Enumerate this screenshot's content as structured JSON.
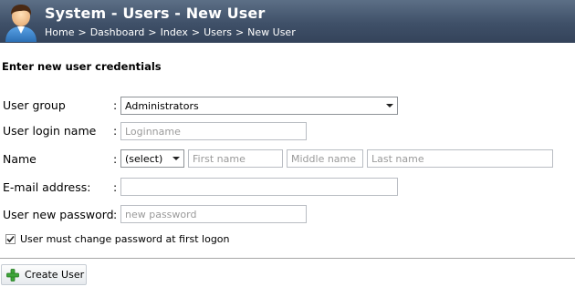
{
  "header": {
    "title": "System - Users - New User",
    "breadcrumb": [
      "Home",
      "Dashboard",
      "Index",
      "Users",
      "New User"
    ],
    "breadcrumb_separator": ">",
    "background_color": "#3f5068"
  },
  "form": {
    "heading": "Enter new user credentials",
    "colon": ":",
    "user_group": {
      "label": "User group",
      "value": "Administrators"
    },
    "login_name": {
      "label": "User login name",
      "placeholder": "Loginname",
      "value": ""
    },
    "name": {
      "label": "Name",
      "title_select": "(select)",
      "first_placeholder": "First name",
      "middle_placeholder": "Middle name",
      "last_placeholder": "Last name"
    },
    "email": {
      "label": "E-mail address:",
      "value": ""
    },
    "password": {
      "label": "User new password",
      "placeholder": "new password",
      "value": ""
    },
    "must_change": {
      "label": "User must change password at first logon",
      "checked": true
    }
  },
  "actions": {
    "create_label": "Create User",
    "create_icon": "plus-icon",
    "create_icon_color": "#3fa53a"
  }
}
